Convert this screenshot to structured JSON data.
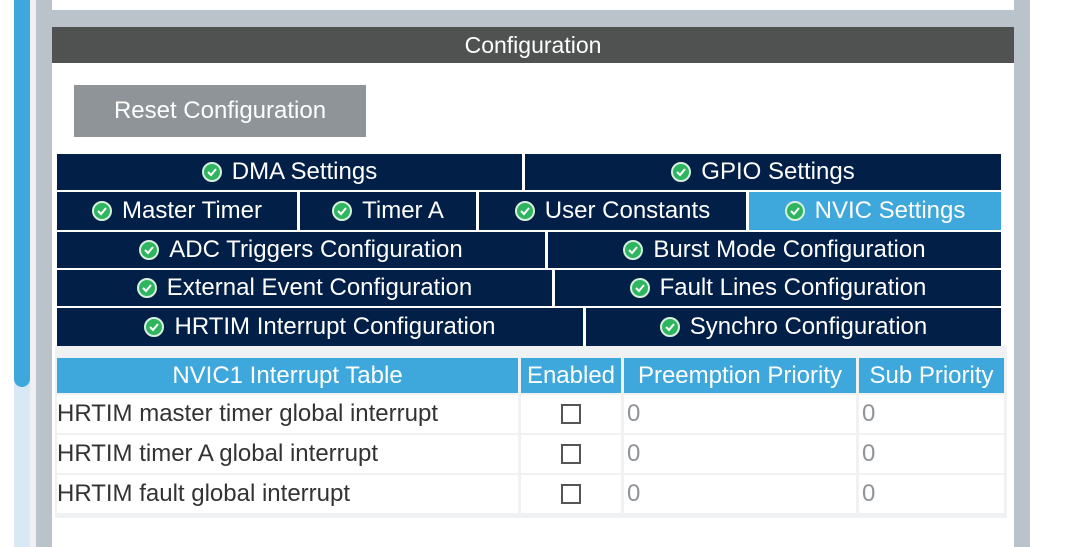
{
  "header": {
    "title": "Configuration"
  },
  "reset_button": "Reset Configuration",
  "tabs": [
    {
      "label": "DMA Settings"
    },
    {
      "label": "GPIO Settings"
    },
    {
      "label": "Master Timer"
    },
    {
      "label": "Timer A"
    },
    {
      "label": "User Constants"
    },
    {
      "label": "NVIC Settings",
      "selected": true
    },
    {
      "label": "ADC Triggers Configuration"
    },
    {
      "label": "Burst Mode Configuration"
    },
    {
      "label": "External Event Configuration"
    },
    {
      "label": "Fault Lines Configuration"
    },
    {
      "label": "HRTIM Interrupt Configuration"
    },
    {
      "label": "Synchro Configuration"
    }
  ],
  "table": {
    "headers": [
      "NVIC1 Interrupt Table",
      "Enabled",
      "Preemption Priority",
      "Sub Priority"
    ],
    "rows": [
      {
        "name": "HRTIM master timer global interrupt",
        "enabled": false,
        "preemption": "0",
        "sub": "0"
      },
      {
        "name": "HRTIM timer A global interrupt",
        "enabled": false,
        "preemption": "0",
        "sub": "0"
      },
      {
        "name": "HRTIM fault global interrupt",
        "enabled": false,
        "preemption": "0",
        "sub": "0"
      }
    ]
  },
  "colors": {
    "accent": "#3ea7dc",
    "tab_bg": "#021f47",
    "header_bg": "#505251",
    "button_bg": "#8f9499"
  }
}
